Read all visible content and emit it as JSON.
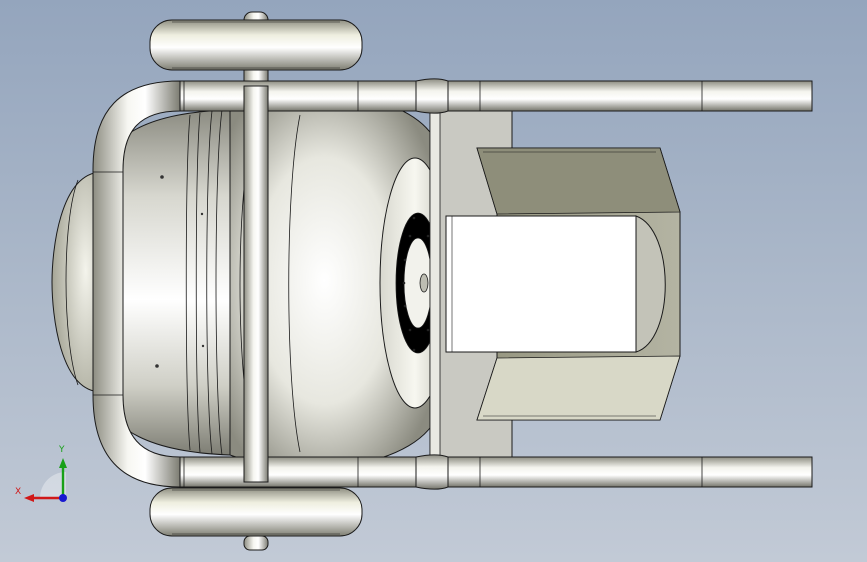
{
  "viewport": {
    "background_top": "#94a5bd",
    "background_bottom": "#c2cad6"
  },
  "model": {
    "body_color": "#e9e9e1",
    "metal_color": "#dedfd6",
    "plate_color": "#c9c9c2",
    "bracket_color": "#a7a795",
    "edge_color": "#1a1a1a"
  },
  "triad": {
    "x_label": "X",
    "y_label": "Y",
    "x_color": "#d01818",
    "y_color": "#18a018",
    "z_color": "#1818d0"
  }
}
